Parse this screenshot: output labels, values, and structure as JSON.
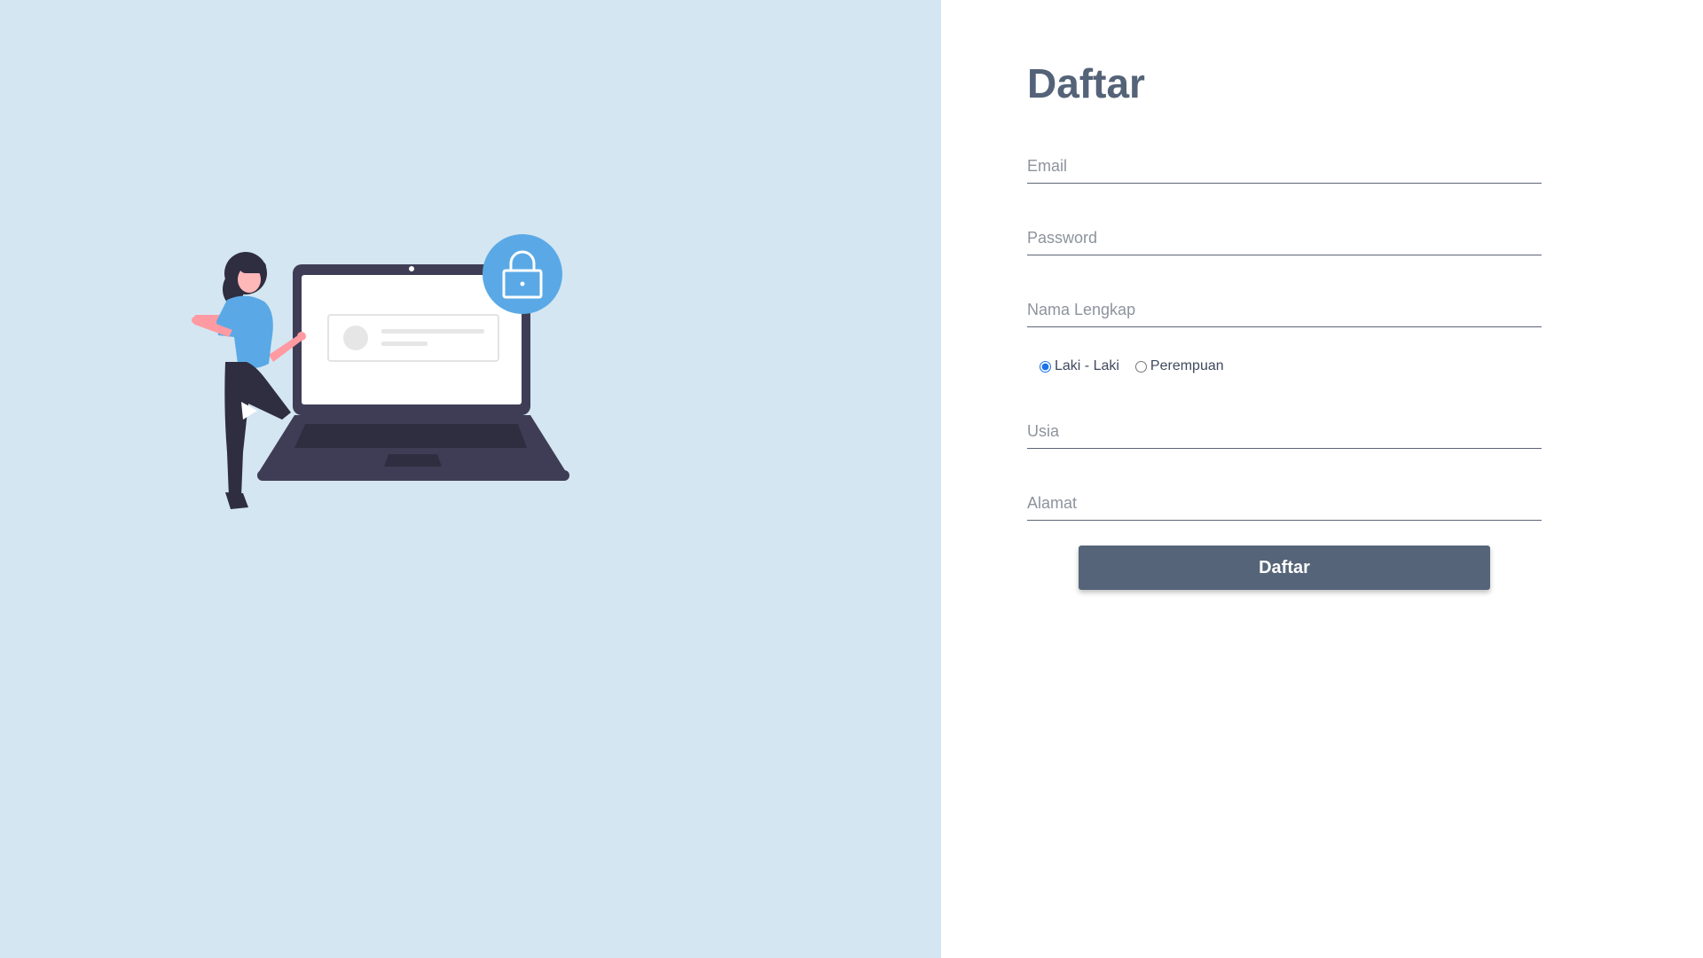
{
  "illustration": {
    "icon": "person-laptop-lock-illustration"
  },
  "form": {
    "title": "Daftar",
    "fields": {
      "email": {
        "placeholder": "Email",
        "value": ""
      },
      "password": {
        "placeholder": "Password",
        "value": ""
      },
      "full_name": {
        "placeholder": "Nama Lengkap",
        "value": ""
      },
      "age": {
        "placeholder": "Usia",
        "value": ""
      },
      "address": {
        "placeholder": "Alamat",
        "value": ""
      }
    },
    "gender": {
      "options": [
        {
          "label": "Laki - Laki",
          "checked": true
        },
        {
          "label": "Perempuan",
          "checked": false
        }
      ]
    },
    "submit_label": "Daftar"
  },
  "colors": {
    "left_background": "#d4e6f1",
    "title": "#546378",
    "button": "#556479",
    "accent_blue": "#5aa9e6",
    "laptop_dark": "#3f3d56"
  }
}
